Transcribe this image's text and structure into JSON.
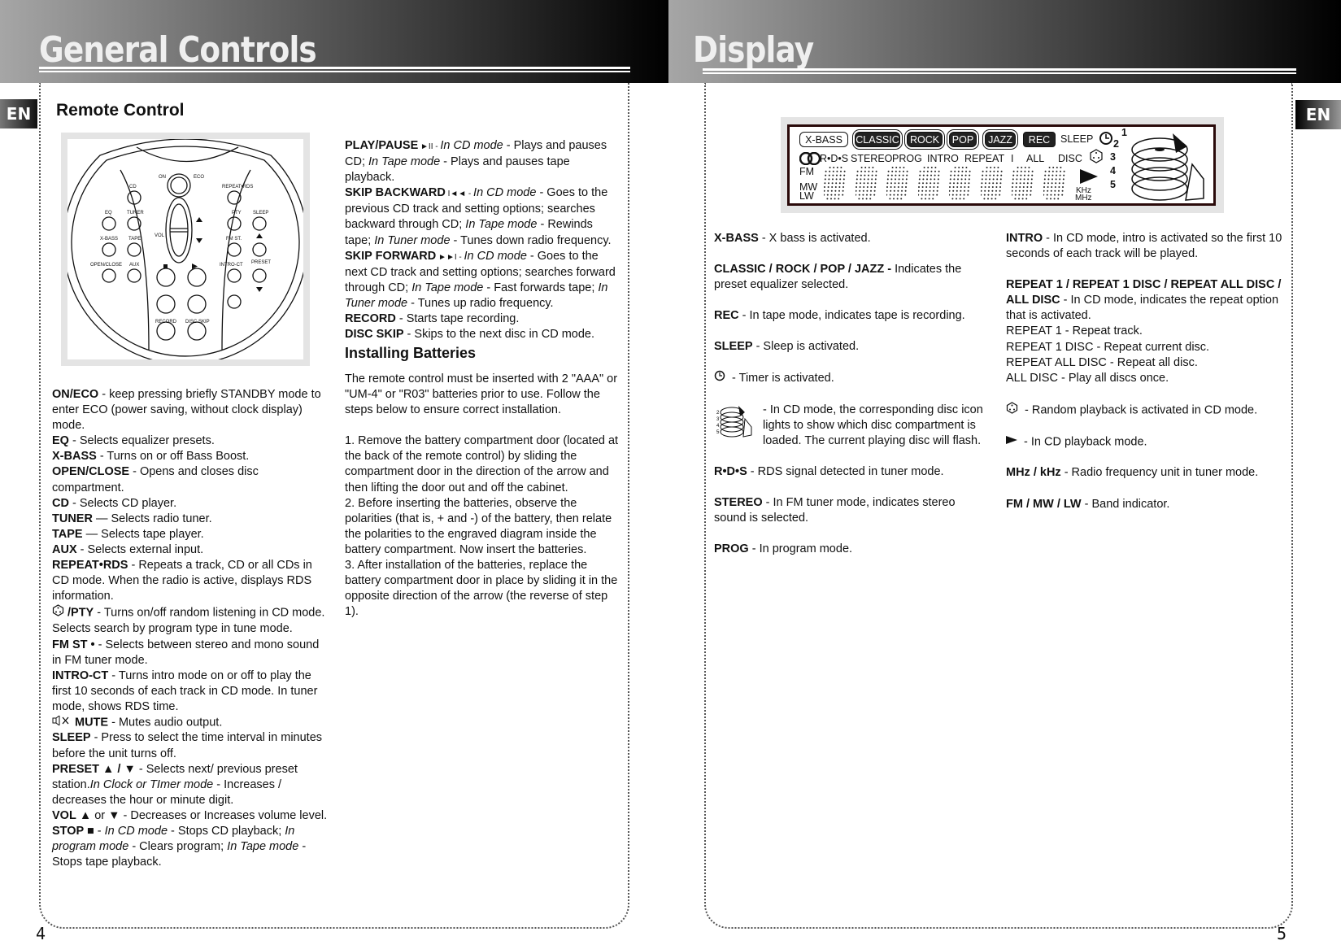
{
  "left_page": {
    "header_title": "General Controls",
    "language_tab": "EN",
    "page_number": "4",
    "remote_section": {
      "title": "Remote Control",
      "diagram": {
        "power": {
          "on": "ON",
          "eco": "ECO"
        },
        "left_buttons": [
          "CD",
          "EQ",
          "TUNER",
          "X-BASS",
          "TAPE",
          "OPEN/CLOSE",
          "AUX"
        ],
        "vol": "VOL",
        "center_buttons": [
          "RECORD",
          "DISC SKIP"
        ],
        "right_buttons": [
          "REPEAT•RDS",
          "PTY",
          "SLEEP",
          "FM ST.",
          "INTRO-CT",
          "PRESET"
        ]
      },
      "descriptions": [
        {
          "term": "ON/ECO",
          "text": "  -  keep pressing briefly STANDBY mode to enter ECO (power saving, without clock display) mode."
        },
        {
          "term": "EQ",
          "text": " - Selects equalizer presets."
        },
        {
          "term": "X-BASS",
          "text": " - Turns on or off Bass Boost."
        },
        {
          "term": "OPEN/CLOSE",
          "text": "  - Opens and closes disc compartment."
        },
        {
          "term": "CD",
          "text": " - Selects CD player."
        },
        {
          "term": "TUNER",
          "text": " — Selects radio tuner."
        },
        {
          "term": "TAPE",
          "text": " — Selects tape player."
        },
        {
          "term": "AUX",
          "text": " - Selects external input."
        },
        {
          "term": "REPEAT•RDS",
          "text": " - Repeats a track, CD or all CDs in CD mode. When the radio is active, displays RDS information."
        },
        {
          "term": "/PTY",
          "text": " - Turns on/off random listening in CD mode. Selects search  by program type in tune mode.",
          "icon": "random-dice-icon"
        },
        {
          "term": "FM ST •",
          "text": " - Selects between stereo and mono sound in FM tuner mode."
        },
        {
          "term": "INTRO-CT",
          "text": " - Turns intro mode on or off to play the first 10 seconds of each track in CD mode.  In tuner mode, shows RDS time."
        },
        {
          "term": "MUTE",
          "text": " - Mutes audio output.",
          "icon": "mute-icon"
        },
        {
          "term": "SLEEP",
          "text": " - Press to select the time interval in minutes before the unit turns off."
        },
        {
          "term": "PRESET ▲ / ▼",
          "text": " - Selects next/ previous preset station.",
          "italic": "In Clock or TImer mode",
          "text2": " - Increases / decreases the hour or minute digit."
        },
        {
          "term": "VOL",
          "text": " ▲ or ▼  - Decreases or Increases volume level."
        },
        {
          "term": "STOP ■",
          "text": "  -  ",
          "italic": "In CD mode",
          "text2": " - Stops CD playback; ",
          "italic2": "In program mode",
          "text3": " - Clears program; ",
          "italic3": "In Tape mode",
          "text4": " - Stops tape playback."
        }
      ]
    },
    "playback_section": {
      "descriptions": [
        {
          "term": "PLAY/PAUSE",
          "symbol": "►II",
          "parts": [
            [
              "i",
              "In CD mode"
            ],
            [
              "t",
              " - Plays and pauses CD; "
            ],
            [
              "i",
              "In Tape mode"
            ],
            [
              "t",
              " - Plays and pauses tape playback."
            ]
          ]
        },
        {
          "term": "SKIP BACKWARD",
          "symbol": "I◄◄",
          "parts": [
            [
              "i",
              "In CD mode"
            ],
            [
              "t",
              " - Goes to the previous CD track and setting options; searches backward through CD; "
            ],
            [
              "i",
              "In Tape mode"
            ],
            [
              "t",
              " - Rewinds tape; "
            ],
            [
              "i",
              "In Tuner mode"
            ],
            [
              "t",
              " - Tunes down radio frequency."
            ]
          ]
        },
        {
          "term": "SKIP FORWARD",
          "symbol": "►►I",
          "parts": [
            [
              "i",
              "In CD mode"
            ],
            [
              "t",
              " - Goes to the next CD track and setting options; searches forward through CD; "
            ],
            [
              "i",
              "In Tape mode"
            ],
            [
              "t",
              " - Fast forwards tape; "
            ],
            [
              "i",
              "In Tuner mode"
            ],
            [
              "t",
              " - Tunes up radio frequency."
            ]
          ]
        },
        {
          "term": "RECORD",
          "text": " - Starts tape recording."
        },
        {
          "term": "DISC SKIP",
          "text": " - Skips to the next disc in CD mode."
        }
      ]
    },
    "batteries_section": {
      "title": "Installing Batteries",
      "intro": "The remote control must be inserted with 2 \"AAA\" or \"UM-4\" or \"R03\" batteries prior to use.  Follow the steps below to ensure correct installation.",
      "steps": [
        "1. Remove the battery compartment door (located at the back of the remote control) by sliding the compartment door in the direction of the arrow and then lifting the door out and off the cabinet.",
        "2. Before inserting the batteries, observe the polarities (that is, + and -) of the battery, then relate the polarities to the engraved diagram inside the battery compartment.  Now insert the batteries.",
        "3. After installation of the batteries, replace the battery compartment door in place by sliding it  in the opposite direction of the arrow (the reverse of step 1)."
      ]
    }
  },
  "right_page": {
    "header_title": "Display",
    "language_tab": "EN",
    "page_number": "5",
    "lcd": {
      "top_row": {
        "xbass": "X-BASS",
        "eq": [
          "CLASSIC",
          "ROCK",
          "POP",
          "JAZZ"
        ],
        "rec": "REC",
        "sleep": "SLEEP"
      },
      "second_row": [
        "R•D•S",
        "STEREO",
        "PROG",
        "INTRO",
        "REPEAT",
        "I",
        "ALL",
        "DISC"
      ],
      "bands": [
        "FM",
        "MW",
        "LW"
      ],
      "units": [
        "KHz",
        "MHz"
      ],
      "disc_numbers": [
        "1",
        "2",
        "3",
        "4",
        "5"
      ]
    },
    "col1": [
      {
        "term": "X-BASS",
        "text": " - X bass is activated."
      },
      {
        "term": "CLASSIC / ROCK / POP / JAZZ  -",
        "text": " Indicates the preset equalizer selected."
      },
      {
        "term": "REC",
        "text": " - In tape mode, indicates tape is recording."
      },
      {
        "term": "SLEEP",
        "text": " - Sleep is activated."
      },
      {
        "icon": "timer-clock-icon",
        "text": "  - Timer is activated."
      },
      {
        "icon": "disc-stack-icon",
        "text": "- In CD mode, the corresponding disc icon lights to show which disc compartment is loaded. The current playing disc will flash."
      },
      {
        "term": "R•D•S",
        "text": " -  RDS signal detected in tuner mode."
      },
      {
        "term": "STEREO",
        "text": " - In FM tuner mode, indicates stereo sound is selected."
      },
      {
        "term": "PROG",
        "text": " - In program mode."
      }
    ],
    "col2": [
      {
        "term": "INTRO",
        "text": " - In CD mode, intro is activated so the first 10 seconds of each track will be played."
      },
      {
        "term": "REPEAT 1 / REPEAT 1 DISC / REPEAT ALL DISC / ALL DISC",
        "text": " - In CD mode, indicates the repeat option that is activated.",
        "lines": [
          "REPEAT 1 - Repeat track.",
          "REPEAT 1 DISC - Repeat current disc.",
          "REPEAT ALL DISC - Repeat all disc.",
          "ALL DISC - Play all discs once."
        ]
      },
      {
        "icon": "random-dice-icon",
        "text": "   - Random playback is activated in CD mode."
      },
      {
        "icon": "play-icon",
        "text": "  - In CD playback mode."
      },
      {
        "term": "MHz / kHz",
        "text": " - Radio frequency unit in tuner mode."
      },
      {
        "term": "FM / MW / LW",
        "text": "  - Band indicator."
      }
    ]
  }
}
